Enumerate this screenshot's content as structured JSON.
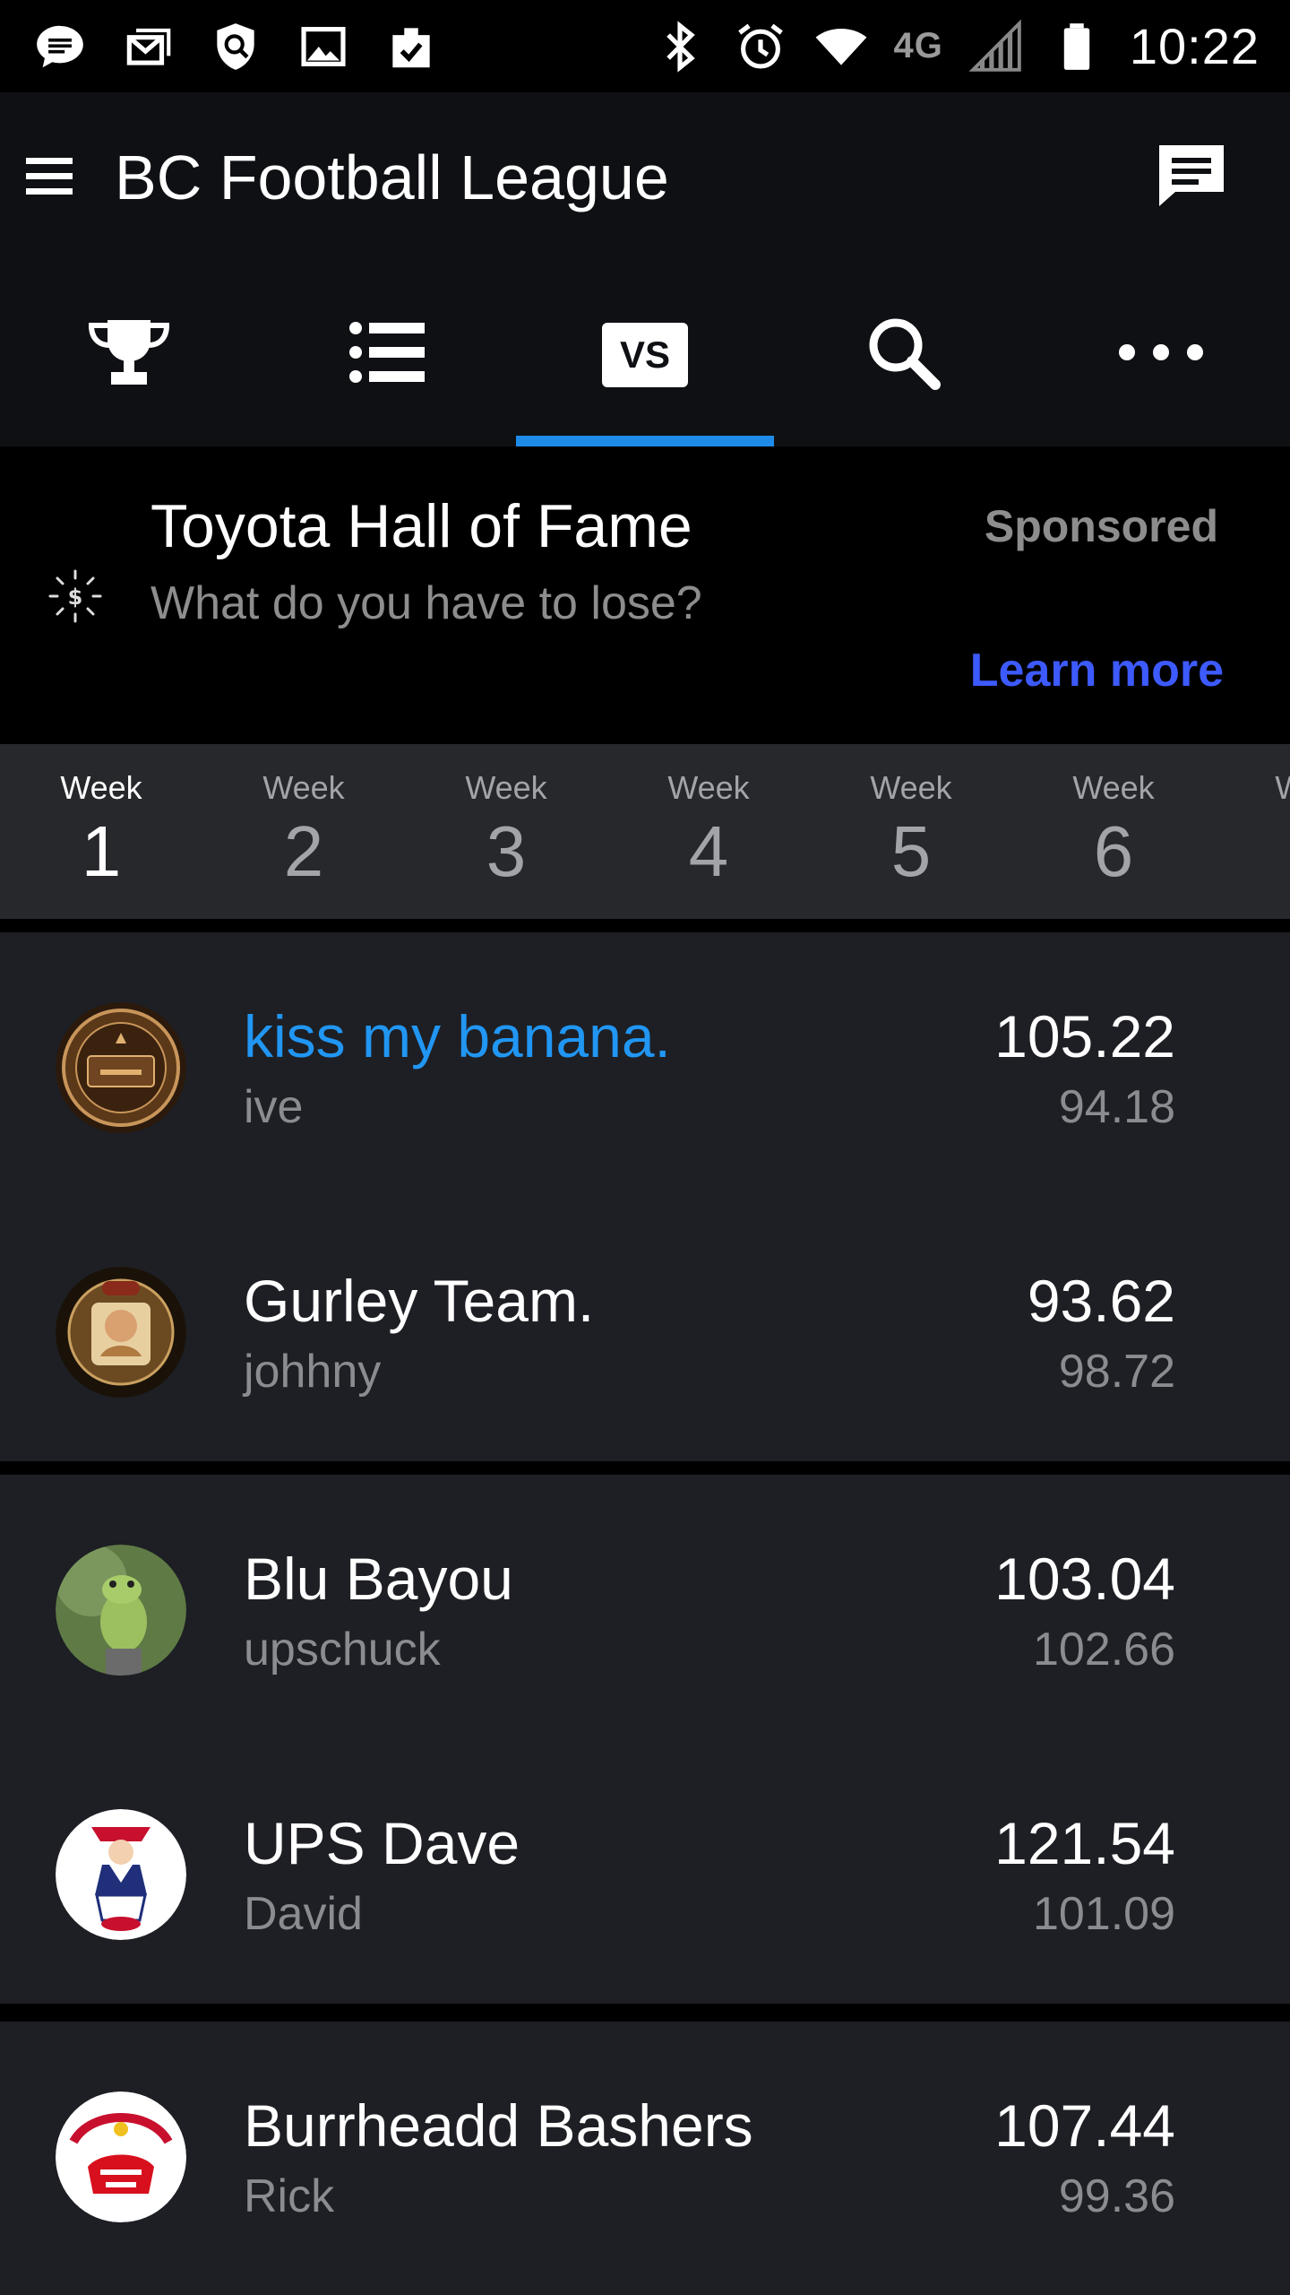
{
  "status_bar": {
    "time": "10:22",
    "network": "4G",
    "left_icons": [
      "messenger-icon",
      "mail-icon",
      "shield-icon",
      "image-icon",
      "clipboard-check-icon"
    ],
    "right_icons": [
      "bluetooth-icon",
      "alarm-icon",
      "wifi-icon",
      "signal-icon",
      "battery-icon"
    ]
  },
  "app_bar": {
    "title": "BC Football League"
  },
  "tabs": [
    {
      "icon": "trophy-icon",
      "active": false
    },
    {
      "icon": "list-icon",
      "active": false
    },
    {
      "icon": "vs-icon",
      "label": "VS",
      "active": true
    },
    {
      "icon": "search-icon",
      "active": false
    },
    {
      "icon": "more-icon",
      "active": false
    }
  ],
  "colors": {
    "accent": "#1e8be8",
    "link": "#3d5afe",
    "my_team": "#2196f3"
  },
  "ad": {
    "title": "Toyota Hall of Fame",
    "subtitle": "What do you have to lose?",
    "sponsored": "Sponsored",
    "cta": "Learn more"
  },
  "weeks": {
    "label": "Week",
    "items": [
      "1",
      "2",
      "3",
      "4",
      "5",
      "6"
    ],
    "selected": "1"
  },
  "matchups": [
    [
      {
        "team": "kiss my banana.",
        "owner": "ive",
        "score": "105.22",
        "projected": "94.18",
        "is_me": true
      },
      {
        "team": "Gurley Team.",
        "owner": "johhny",
        "score": "93.62",
        "projected": "98.72"
      }
    ],
    [
      {
        "team": "Blu Bayou",
        "owner": "upschuck",
        "score": "103.04",
        "projected": "102.66"
      },
      {
        "team": "UPS Dave",
        "owner": "David",
        "score": "121.54",
        "projected": "101.09"
      }
    ],
    [
      {
        "team": "Burrheadd Bashers",
        "owner": "Rick",
        "score": "107.44",
        "projected": "99.36"
      }
    ]
  ]
}
